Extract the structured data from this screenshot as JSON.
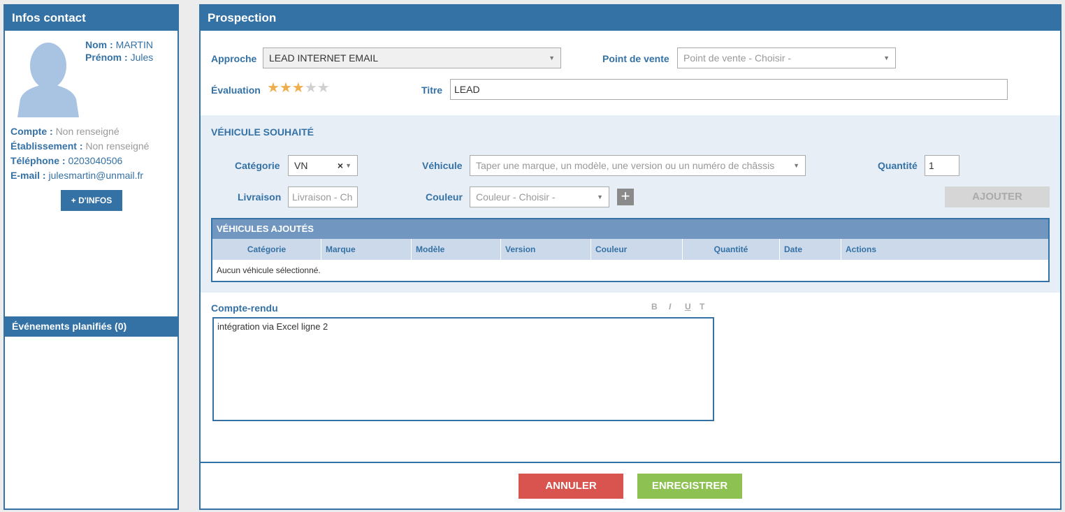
{
  "contact": {
    "header": "Infos contact",
    "nom_label": "Nom :",
    "nom": "MARTIN",
    "prenom_label": "Prénom :",
    "prenom": "Jules",
    "compte_label": "Compte :",
    "compte": "Non renseigné",
    "etab_label": "Établissement :",
    "etab": "Non renseigné",
    "tel_label": "Téléphone :",
    "tel": "0203040506",
    "email_label": "E-mail :",
    "email": "julesmartin@unmail.fr",
    "more_button": "+ D'INFOS",
    "events_header": "Événements planifiés (0)"
  },
  "prospection": {
    "header": "Prospection",
    "approche_label": "Approche",
    "approche_value": "LEAD INTERNET EMAIL",
    "pdv_label": "Point de vente",
    "pdv_placeholder": "Point de vente - Choisir -",
    "eval_label": "Évaluation",
    "rating": 3,
    "rating_max": 5,
    "titre_label": "Titre",
    "titre_value": "LEAD"
  },
  "vehicle": {
    "section_title": "VÉHICULE SOUHAITÉ",
    "categorie_label": "Catégorie",
    "categorie_value": "VN",
    "clear_symbol": "×",
    "vehicule_label": "Véhicule",
    "vehicule_placeholder": "Taper une marque, un modèle, une version ou un numéro de châssis",
    "quantite_label": "Quantité",
    "quantite_value": "1",
    "livraison_label": "Livraison",
    "livraison_placeholder": "Livraison - Ch",
    "couleur_label": "Couleur",
    "couleur_placeholder": "Couleur - Choisir -",
    "add_symbol": "+",
    "ajouter_button": "AJOUTER"
  },
  "table": {
    "title": "VÉHICULES AJOUTÉS",
    "columns": [
      "Catégorie",
      "Marque",
      "Modèle",
      "Version",
      "Couleur",
      "Quantité",
      "Date",
      "Actions"
    ],
    "empty_message": "Aucun véhicule sélectionné."
  },
  "compte_rendu": {
    "label": "Compte-rendu",
    "tools": [
      "B",
      "I",
      "U",
      "T"
    ],
    "text": "intégration via Excel ligne 2"
  },
  "footer": {
    "cancel": "ANNULER",
    "save": "ENREGISTRER"
  },
  "colors": {
    "primary": "#3471a5",
    "cancel": "#d9534f",
    "save": "#8dc152",
    "star_on": "#f0ad4e",
    "star_off": "#d0d0d0"
  }
}
